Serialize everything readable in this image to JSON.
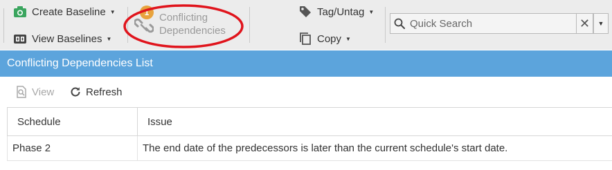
{
  "toolbar": {
    "create_baseline": "Create Baseline",
    "view_baselines": "View Baselines",
    "conflicting": {
      "badge": "1",
      "line1": "Conflicting",
      "line2": "Dependencies"
    },
    "tag_untag": "Tag/Untag",
    "copy": "Copy",
    "search": {
      "placeholder": "Quick Search",
      "value": ""
    }
  },
  "panel": {
    "title": "Conflicting Dependencies List",
    "actions": {
      "view": "View",
      "refresh": "Refresh"
    },
    "columns": [
      "Schedule",
      "Issue"
    ],
    "rows": [
      {
        "schedule": "Phase 2",
        "issue": "The end date of the predecessors is later than the current schedule's start date."
      }
    ]
  },
  "colors": {
    "toolbar_bg": "#ececec",
    "header_bg": "#5ca4dc",
    "badge": "#e8a33d",
    "annotation": "#e0141c",
    "icon_green": "#3aa55e",
    "disabled_text": "#9a9a9a"
  },
  "icons": {
    "create_baseline": "camera-icon",
    "view_baselines": "baselines-icon",
    "conflicting": "link-icon",
    "tag_untag": "tag-icon",
    "copy": "copy-icon",
    "search": "search-icon",
    "clear": "close-icon",
    "dropdown": "caret-down-icon",
    "view": "view-icon",
    "refresh": "refresh-icon"
  }
}
